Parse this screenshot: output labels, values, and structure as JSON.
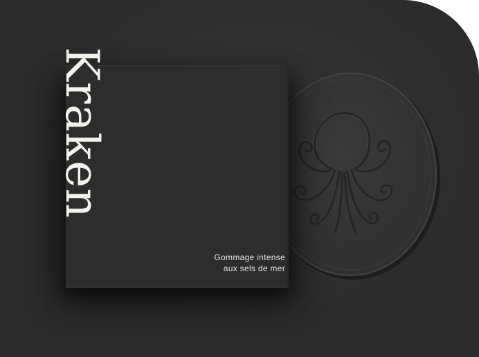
{
  "product": {
    "brand": "Kraken",
    "tagline_line1": "Gommage intense",
    "tagline_line2": "aux sels de mer"
  },
  "colors": {
    "background": "#2c2c2c",
    "box": "#2d2d2e",
    "soap": "#353536",
    "text": "#f3f1ec"
  },
  "icons": {
    "soap_emboss": "octopus-icon"
  }
}
